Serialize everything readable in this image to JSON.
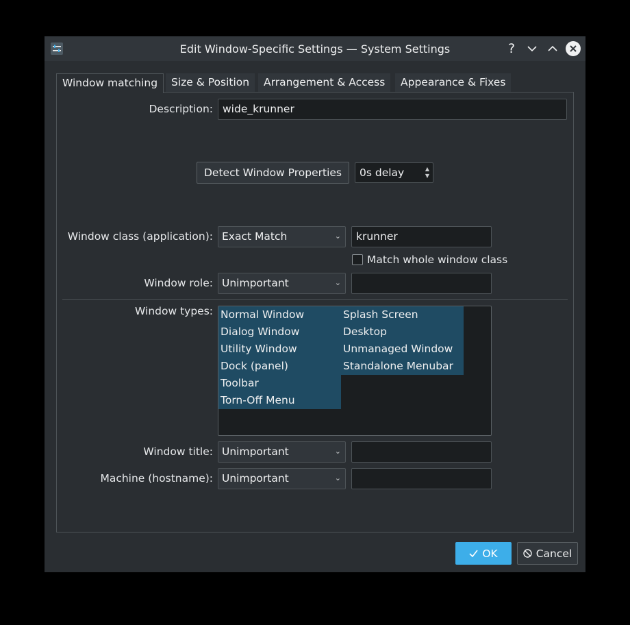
{
  "window": {
    "title": "Edit Window-Specific Settings — System Settings"
  },
  "titlebar": {
    "help": "?",
    "minimize": "⌄",
    "maximize": "⌃",
    "close": "×"
  },
  "tabs": [
    {
      "label": "Window matching",
      "active": true
    },
    {
      "label": "Size & Position",
      "active": false
    },
    {
      "label": "Arrangement & Access",
      "active": false
    },
    {
      "label": "Appearance & Fixes",
      "active": false
    }
  ],
  "description": {
    "label": "Description:",
    "value": "wide_krunner"
  },
  "detect": {
    "button_label": "Detect Window Properties",
    "delay_value": "0s delay"
  },
  "window_class": {
    "label": "Window class (application):",
    "match": "Exact Match",
    "value": "krunner",
    "whole_class_label": "Match whole window class",
    "whole_class_checked": false
  },
  "window_role": {
    "label": "Window role:",
    "match": "Unimportant",
    "value": ""
  },
  "window_types": {
    "label": "Window types:",
    "column1": [
      "Normal Window",
      "Dialog Window",
      "Utility Window",
      "Dock (panel)",
      "Toolbar",
      "Torn-Off Menu"
    ],
    "column2": [
      "Splash Screen",
      "Desktop",
      "Unmanaged Window",
      "Standalone Menubar"
    ]
  },
  "window_title": {
    "label": "Window title:",
    "match": "Unimportant",
    "value": ""
  },
  "machine": {
    "label": "Machine (hostname):",
    "match": "Unimportant",
    "value": ""
  },
  "footer": {
    "ok_label": "OK",
    "cancel_label": "Cancel"
  },
  "colors": {
    "accent": "#3daee9",
    "selection": "#1f4b63",
    "window_bg": "#2a2e32"
  }
}
